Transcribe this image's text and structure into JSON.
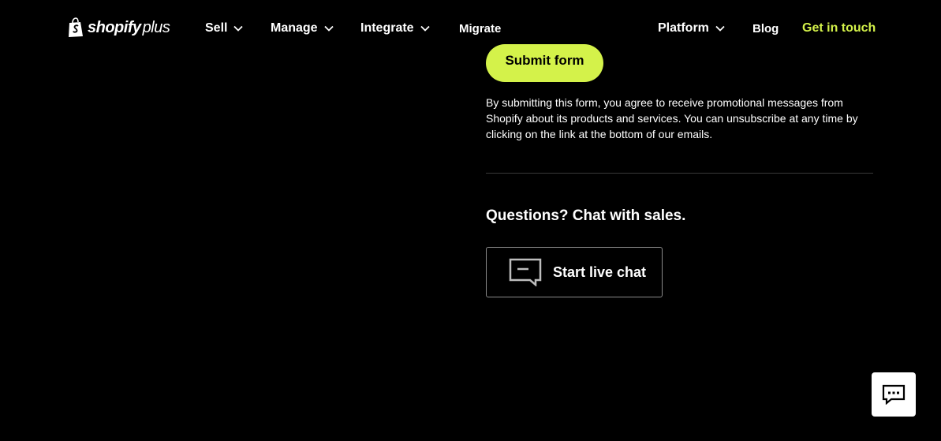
{
  "header": {
    "logo": {
      "word": "shopify",
      "suffix": "plus"
    },
    "nav_left": [
      {
        "label": "Sell",
        "has_dropdown": true
      },
      {
        "label": "Manage",
        "has_dropdown": true
      },
      {
        "label": "Integrate",
        "has_dropdown": true
      },
      {
        "label": "Migrate",
        "has_dropdown": false
      }
    ],
    "nav_right": [
      {
        "label": "Platform",
        "has_dropdown": true
      },
      {
        "label": "Blog",
        "has_dropdown": false
      },
      {
        "label": "Get in touch",
        "has_dropdown": false
      }
    ]
  },
  "form": {
    "submit_label": "Submit form",
    "disclaimer": "By submitting this form, you agree to receive promotional messages from Shopify about its products and services. You can unsubscribe at any time by clicking on the link at the bottom of our emails."
  },
  "sales_chat": {
    "heading": "Questions? Chat with sales.",
    "button_label": "Start live chat",
    "icon": "chat-bubble-icon"
  },
  "chat_widget": {
    "icon": "chat-dots-icon"
  },
  "colors": {
    "background": "#000000",
    "accent": "#d4f24a",
    "text": "#ffffff",
    "divider": "#3a3a3a",
    "button_border": "#8a8a8a"
  }
}
